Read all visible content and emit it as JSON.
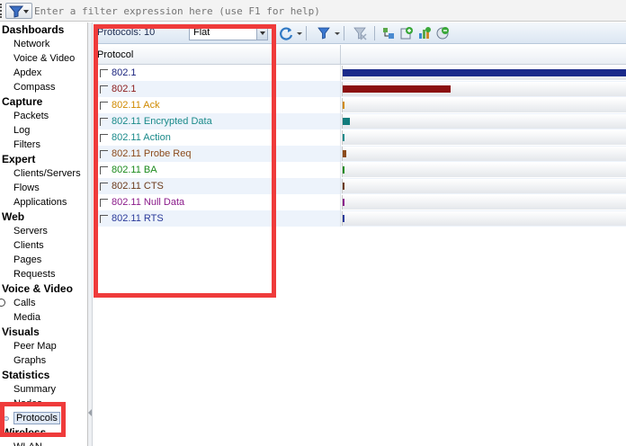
{
  "filter": {
    "placeholder": "Enter a filter expression here (use F1 for help)"
  },
  "sidebar": {
    "sections": [
      {
        "title": "Dashboards",
        "items": [
          "Network",
          "Voice & Video",
          "Apdex",
          "Compass"
        ]
      },
      {
        "title": "Capture",
        "items": [
          "Packets",
          "Log",
          "Filters"
        ]
      },
      {
        "title": "Expert",
        "items": [
          "Clients/Servers",
          "Flows",
          "Applications"
        ]
      },
      {
        "title": "Web",
        "items": [
          "Servers",
          "Clients",
          "Pages",
          "Requests"
        ]
      },
      {
        "title": "Voice & Video",
        "items": [
          "Calls",
          "Media"
        ]
      },
      {
        "title": "Visuals",
        "items": [
          "Peer Map",
          "Graphs"
        ]
      },
      {
        "title": "Statistics",
        "items": [
          "Summary",
          "Nodes",
          "Protocols"
        ]
      },
      {
        "title": "Wireless",
        "items": [
          "WLAN"
        ]
      }
    ],
    "active_item": "Protocols"
  },
  "toolbar": {
    "protocols_label": "Protocols: 10",
    "view_mode": "Flat"
  },
  "table": {
    "header": "Protocol",
    "rows": [
      {
        "name": "802.1",
        "color": "#1a237e",
        "level": 1.0,
        "bar": "#1a2a8a"
      },
      {
        "name": "802.1",
        "color": "#8b1a1a",
        "level": 0.38,
        "bar": "#8b1010"
      },
      {
        "name": "802.11 Ack",
        "color": "#d08a00",
        "level": 0.004,
        "bar": "#d08a00"
      },
      {
        "name": "802.11 Encrypted Data",
        "color": "#1a8a8a",
        "level": 0.025,
        "bar": "#127c7c"
      },
      {
        "name": "802.11 Action",
        "color": "#1a8a8a",
        "level": 0.004,
        "bar": "#1a8a8a"
      },
      {
        "name": "802.11 Probe Req",
        "color": "#8b4a1a",
        "level": 0.012,
        "bar": "#8b4a1a"
      },
      {
        "name": "802.11 BA",
        "color": "#1a8a1a",
        "level": 0.004,
        "bar": "#1a8a1a"
      },
      {
        "name": "802.11 CTS",
        "color": "#6a3a1a",
        "level": 0.004,
        "bar": "#6a3a1a"
      },
      {
        "name": "802.11 Null Data",
        "color": "#8a1a8a",
        "level": 0.004,
        "bar": "#8a1a8a"
      },
      {
        "name": "802.11 RTS",
        "color": "#2a3a9a",
        "level": 0.004,
        "bar": "#2a3a9a"
      }
    ]
  },
  "colors": {
    "annotation": "#ef3b3b",
    "alt_row": "#edf3fb"
  }
}
